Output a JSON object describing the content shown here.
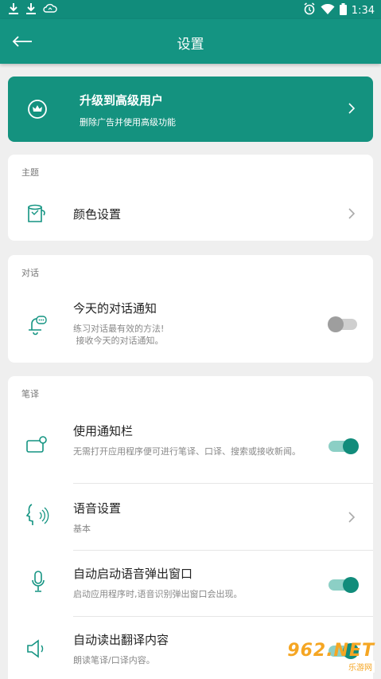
{
  "status_bar": {
    "time": "1:34",
    "icons": [
      "download-icon",
      "download-icon",
      "cloud-sync-icon",
      "alarm-icon",
      "wifi-icon",
      "battery-icon"
    ]
  },
  "app_bar": {
    "title": "设置",
    "back_icon": "arrow-left-icon"
  },
  "premium": {
    "title": "升级到高级用户",
    "subtitle": "删除广告并使用高级功能",
    "icon": "crown-icon"
  },
  "theme_section": {
    "label": "主题",
    "color_setting": {
      "title": "颜色设置",
      "icon": "paint-bucket-icon"
    }
  },
  "dialog_section": {
    "label": "对话",
    "daily_notification": {
      "title": "今天的对话通知",
      "desc_line1": "练习对话最有效的方法!",
      "desc_line2": " 接收今天的对话通知。",
      "enabled": false,
      "icon": "bell-chat-icon"
    }
  },
  "translate_section": {
    "label": "笔译",
    "notification_bar": {
      "title": "使用通知栏",
      "desc": "无需打开应用程序便可进行笔译、口译、搜索或接收新闻。",
      "enabled": true,
      "icon": "notification-card-icon"
    },
    "voice_settings": {
      "title": "语音设置",
      "desc": "基本",
      "icon": "voice-head-icon"
    },
    "auto_voice_popup": {
      "title": "自动启动语音弹出窗口",
      "desc": "启动应用程序时,语音识别弹出窗口会出现。",
      "enabled": true,
      "icon": "microphone-icon"
    },
    "auto_read": {
      "title": "自动读出翻译内容",
      "desc": "朗读笔译/口译内容。",
      "enabled": true,
      "icon": "speaker-icon"
    }
  },
  "watermark": {
    "num": "962.NET",
    "sub": "乐游网"
  },
  "colors": {
    "primary": "#149482",
    "status_bar": "#118c7b",
    "background": "#efefef"
  }
}
